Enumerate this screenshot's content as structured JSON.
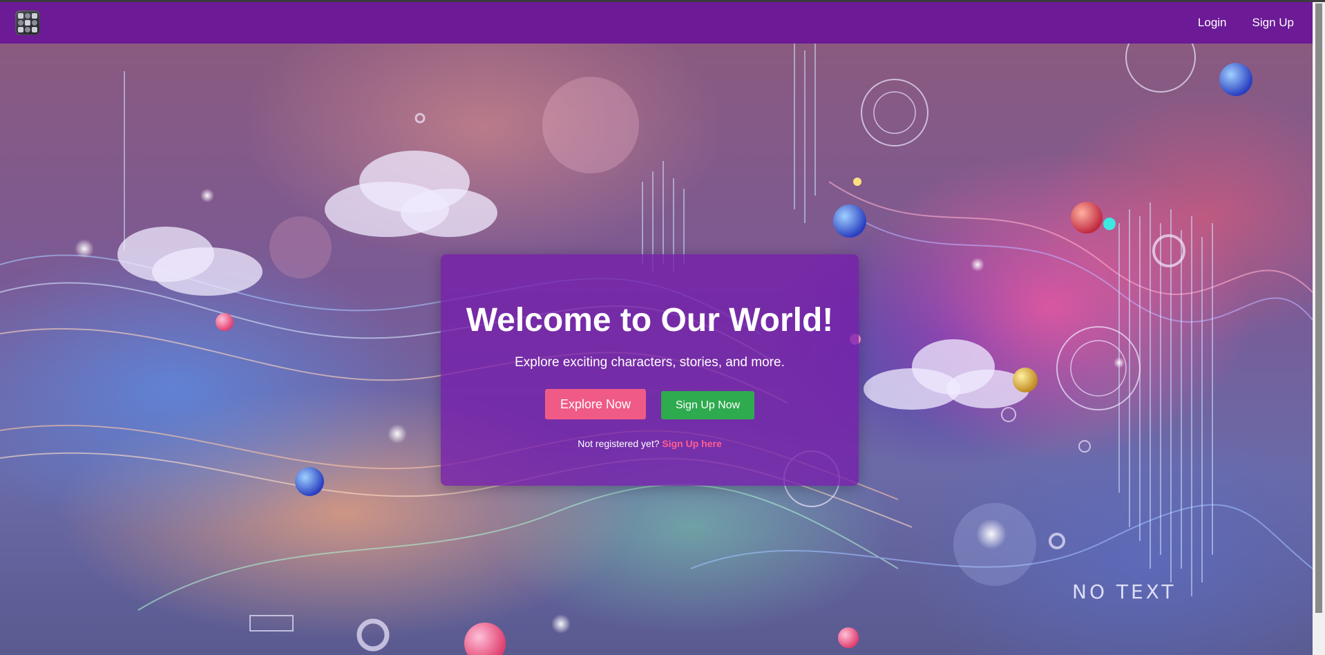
{
  "navbar": {
    "logo": "app-logo-icon",
    "login_label": "Login",
    "signup_label": "Sign Up",
    "background": "#6c1a96"
  },
  "hero": {
    "watermark_text": "NO TEXT"
  },
  "card": {
    "title": "Welcome to Our World!",
    "subtitle": "Explore exciting characters, stories, and more.",
    "explore_button": "Explore Now",
    "signup_button": "Sign Up Now",
    "footer_text": "Not registered yet?",
    "footer_link": "Sign Up here",
    "colors": {
      "explore": "#ef5b86",
      "signup": "#2eaa4f",
      "link": "#ff5e92"
    }
  }
}
